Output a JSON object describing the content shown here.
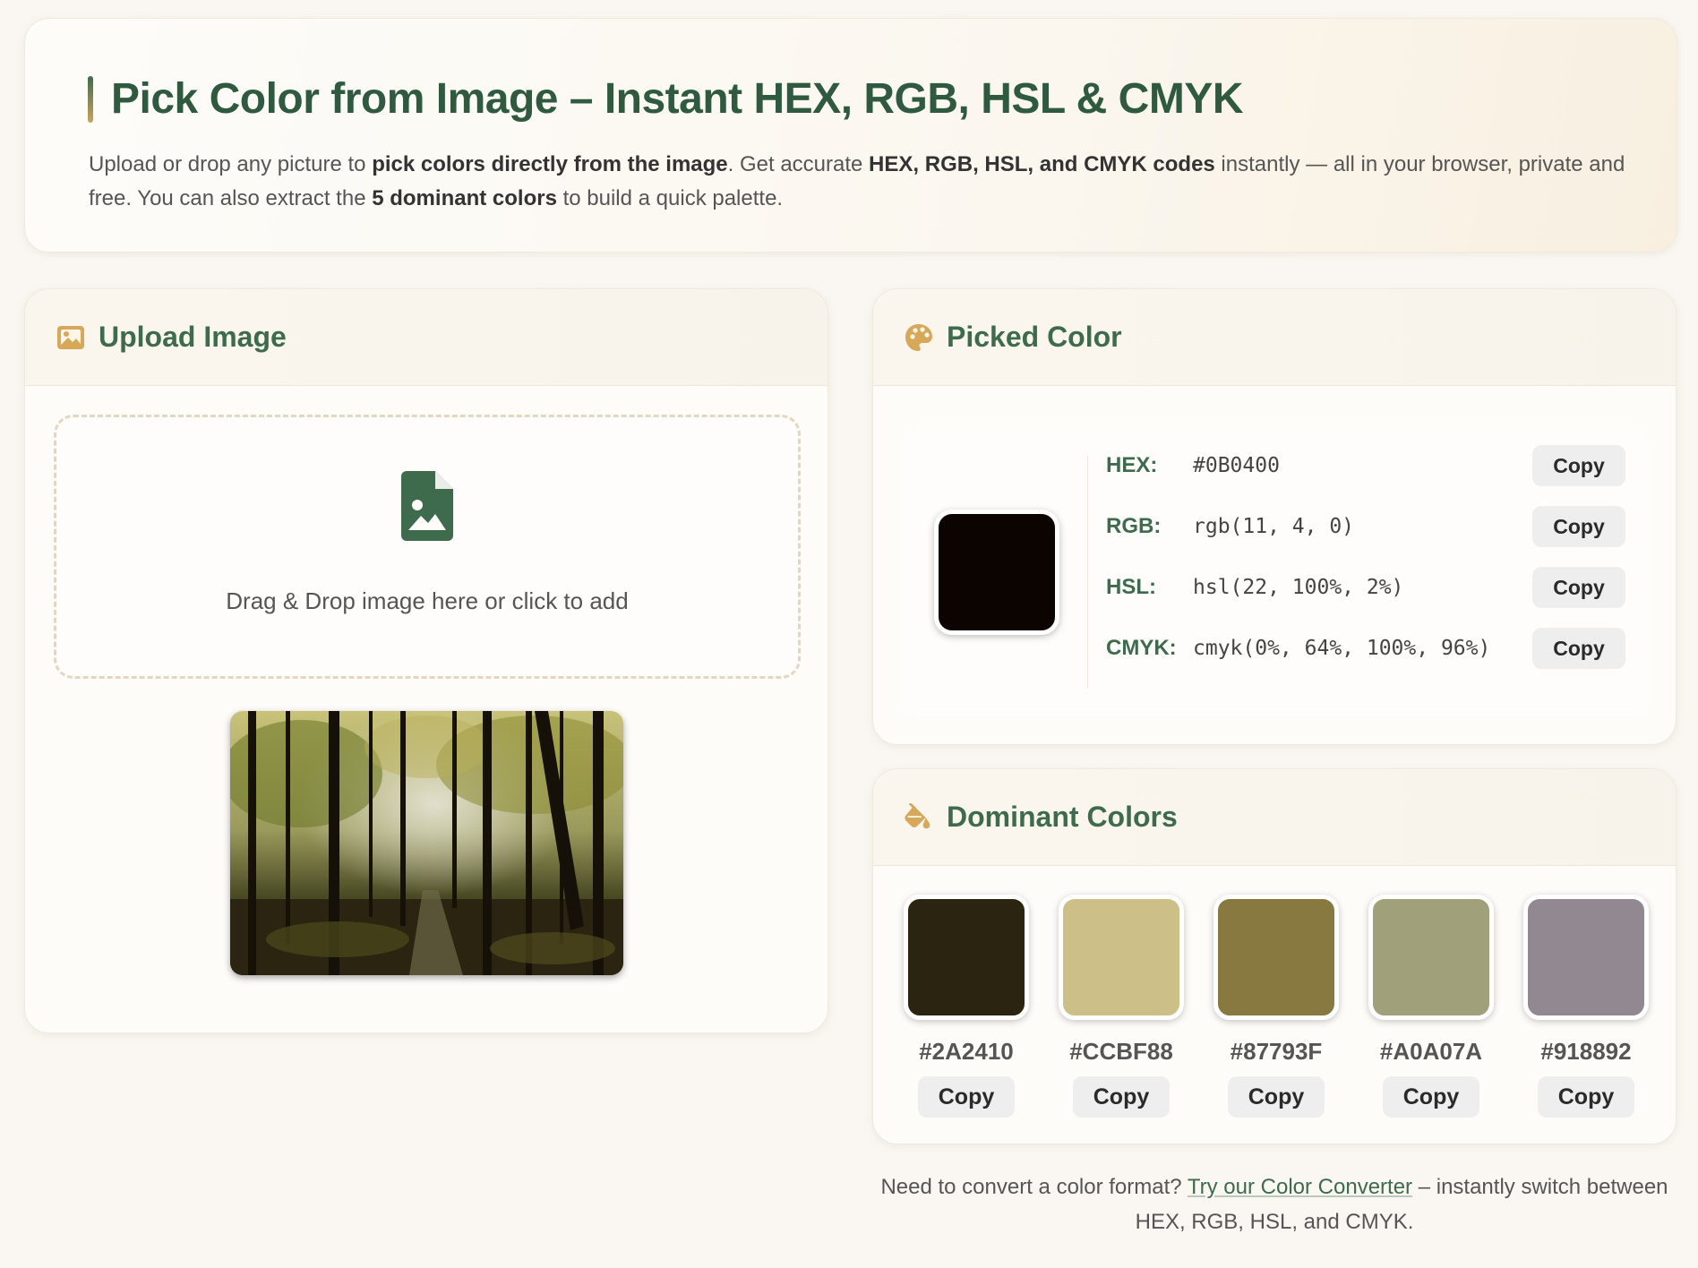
{
  "hero": {
    "title": "Pick Color from Image – Instant HEX, RGB, HSL & CMYK",
    "desc_1": "Upload or drop any picture to ",
    "desc_b1": "pick colors directly from the image",
    "desc_2": ". Get accurate ",
    "desc_b2": "HEX, RGB, HSL, and CMYK codes",
    "desc_3": " instantly — all in your browser, private and free. You can also extract the ",
    "desc_b3": "5 dominant colors",
    "desc_4": " to build a quick palette."
  },
  "upload": {
    "heading": "Upload Image",
    "icon": "image-icon",
    "drop_icon": "file-image-icon",
    "drop_text": "Drag & Drop image here or click to add"
  },
  "picked": {
    "heading": "Picked Color",
    "icon": "palette-icon",
    "color": "#0B0400",
    "rows": [
      {
        "label": "HEX:",
        "value": "#0B0400",
        "copy": "Copy"
      },
      {
        "label": "RGB:",
        "value": "rgb(11, 4, 0)",
        "copy": "Copy"
      },
      {
        "label": "HSL:",
        "value": "hsl(22, 100%, 2%)",
        "copy": "Copy"
      },
      {
        "label": "CMYK:",
        "value": "cmyk(0%, 64%, 100%, 96%)",
        "copy": "Copy"
      }
    ]
  },
  "dominant": {
    "heading": "Dominant Colors",
    "icon": "paint-bucket-icon",
    "colors": [
      {
        "hex": "#2A2410",
        "copy": "Copy"
      },
      {
        "hex": "#CCBF88",
        "copy": "Copy"
      },
      {
        "hex": "#87793F",
        "copy": "Copy"
      },
      {
        "hex": "#A0A07A",
        "copy": "Copy"
      },
      {
        "hex": "#918892",
        "copy": "Copy"
      }
    ]
  },
  "footer": {
    "text_1": "Need to convert a color format? ",
    "link": "Try our Color Converter",
    "text_2": " – instantly switch between HEX, RGB, HSL, and CMYK."
  },
  "colors": {
    "accent_green": "#3e6b4c",
    "accent_gold": "#c9a45c"
  }
}
